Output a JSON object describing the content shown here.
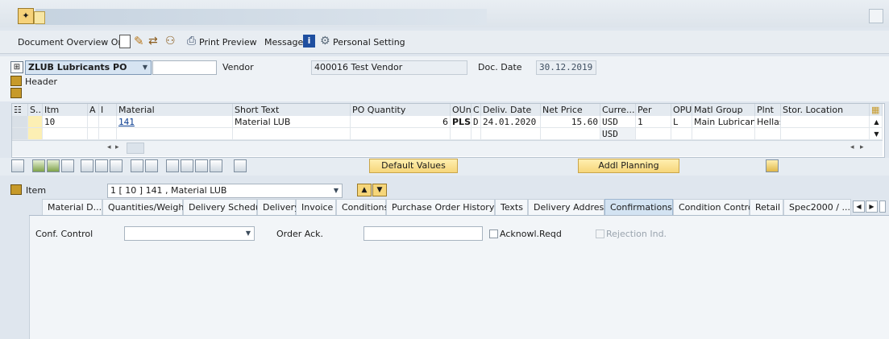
{
  "toolbar": {
    "doc_overview": "Document Overview On",
    "print_preview": "Print Preview",
    "messages": "Messages",
    "personal_setting": "Personal Setting"
  },
  "header": {
    "po_type": "ZLUB Lubricants PO",
    "po_number": "",
    "vendor_label": "Vendor",
    "vendor_value": "400016 Test Vendor",
    "doc_date_label": "Doc. Date",
    "doc_date_value": "30.12.2019",
    "header_label": "Header"
  },
  "table": {
    "columns": [
      "S...",
      "Itm",
      "A",
      "I",
      "Material",
      "Short Text",
      "PO Quantity",
      "OUn",
      "C",
      "Deliv. Date",
      "Net Price",
      "Curre...",
      "Per",
      "OPU",
      "Matl Group",
      "Plnt",
      "Stor. Location"
    ],
    "row1": {
      "itm": "10",
      "material": "141",
      "short_text": "Material LUB",
      "po_qty": "6",
      "oun": "PLS",
      "c": "D",
      "deliv_date": "24.01.2020",
      "net_price": "15.60",
      "curr": "USD",
      "per": "1",
      "opu": "L",
      "matl_group": "Main Lubricants",
      "plnt": "Hellas"
    },
    "row2": {
      "curr": "USD"
    }
  },
  "actions": {
    "default_values": "Default Values",
    "addl_planning": "Addl Planning"
  },
  "item": {
    "label": "Item",
    "selected": "1 [ 10 ] 141 , Material LUB"
  },
  "tabs": [
    "Material D...",
    "Quantities/Weights",
    "Delivery Schedule",
    "Delivery",
    "Invoice",
    "Conditions",
    "Purchase Order History",
    "Texts",
    "Delivery Address",
    "Confirmations",
    "Condition Control",
    "Retail",
    "Spec2000 / ..."
  ],
  "confirmations": {
    "conf_control_label": "Conf. Control",
    "conf_control_value": "",
    "order_ack_label": "Order Ack.",
    "order_ack_value": "",
    "ack_reqd": "Acknowl.Reqd",
    "rejection_ind": "Rejection Ind."
  },
  "colors": {
    "accent_yellow": "#f6d67a",
    "active_tab": "#d3e3f2",
    "link_blue": "#0a3d91"
  }
}
